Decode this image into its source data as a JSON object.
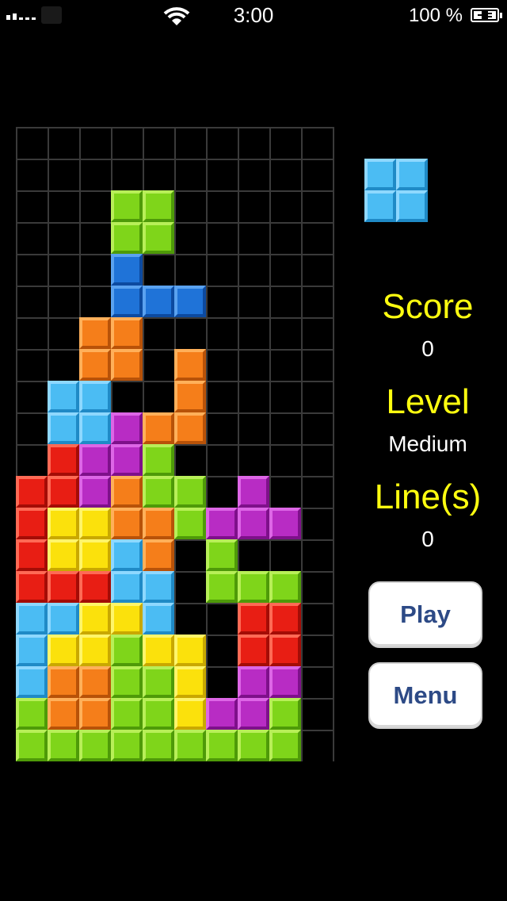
{
  "status_bar": {
    "time": "3:00",
    "battery_percent": "100 %",
    "battery_level": 1.0,
    "signal_bars": 2,
    "wifi_icon": "wifi-icon",
    "battery_icon": "battery-charging-icon"
  },
  "colors": {
    "green": {
      "face": "#7fd51a",
      "light": "#b8ef58",
      "dark": "#4e9a08"
    },
    "blue": {
      "face": "#1f73d8",
      "light": "#5aa2f0",
      "dark": "#0c4aa0"
    },
    "orange": {
      "face": "#f57e1a",
      "light": "#ffb05a",
      "dark": "#b85208"
    },
    "cyan": {
      "face": "#4bbcf3",
      "light": "#8ed8ff",
      "dark": "#1f8ac6"
    },
    "purple": {
      "face": "#b82cc4",
      "light": "#dd66e6",
      "dark": "#7e108a"
    },
    "red": {
      "face": "#e81e14",
      "light": "#ff6a55",
      "dark": "#a40c06"
    },
    "yellow": {
      "face": "#fbe10c",
      "light": "#fff56a",
      "dark": "#c9a800"
    },
    "label": "#ffff10",
    "button_text": "#2d4a86"
  },
  "board": {
    "columns": 10,
    "rows": 20,
    "rows_data": [
      "..........",
      "..........",
      "...GG.....",
      "...GG.....",
      "...B......",
      "...BBB....",
      "..OO......",
      "..OO.O....",
      ".CC..O....",
      ".CCPOO....",
      ".RPPG.....",
      "RRPOGG.P..",
      "RYYOOGPPP.",
      "RYYCO.G...",
      "RRRCC.GGG.",
      "CCYYC..RR.",
      "CYYGYY.RR.",
      "COOGGY.PP.",
      "GOOGGYPPG.",
      "GGGGGGGGG."
    ]
  },
  "next_piece": {
    "color": "cyan",
    "shape": [
      "XX",
      "XX"
    ]
  },
  "panel": {
    "score_label": "Score",
    "score_value": "0",
    "level_label": "Level",
    "level_value": "Medium",
    "lines_label": "Line(s)",
    "lines_value": "0"
  },
  "buttons": {
    "play": "Play",
    "menu": "Menu"
  }
}
